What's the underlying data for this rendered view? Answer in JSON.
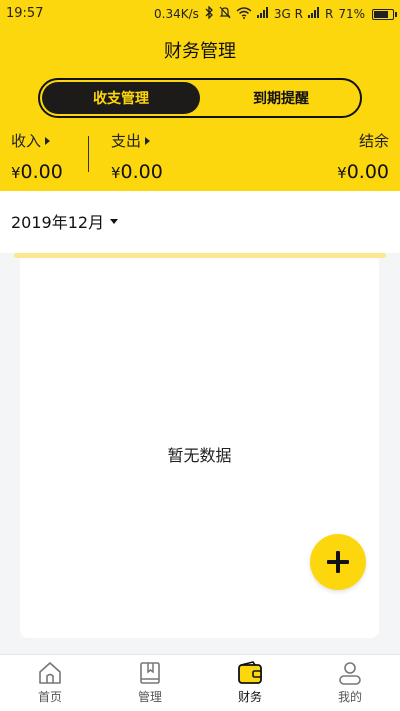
{
  "status_bar": {
    "time": "19:57",
    "speed": "0.34K/s",
    "network_1": "3G R",
    "network_2": "R",
    "battery": "71%"
  },
  "header": {
    "title": "财务管理"
  },
  "tabs": [
    {
      "label": "收支管理",
      "active": true
    },
    {
      "label": "到期提醒",
      "active": false
    }
  ],
  "summary": {
    "income_label": "收入",
    "income_amount": "0.00",
    "expense_label": "支出",
    "expense_amount": "0.00",
    "balance_label": "结余",
    "balance_amount": "0.00",
    "currency": "¥"
  },
  "month_selector": {
    "value": "2019年12月"
  },
  "content": {
    "empty_text": "暂无数据"
  },
  "bottom_nav": [
    {
      "label": "首页",
      "icon": "home-icon",
      "active": false
    },
    {
      "label": "管理",
      "icon": "book-icon",
      "active": false
    },
    {
      "label": "财务",
      "icon": "wallet-icon",
      "active": true
    },
    {
      "label": "我的",
      "icon": "person-icon",
      "active": false
    }
  ],
  "colors": {
    "brand_yellow": "#fdd70e",
    "dark": "#1d1b1a",
    "background": "#f4f5f7"
  }
}
